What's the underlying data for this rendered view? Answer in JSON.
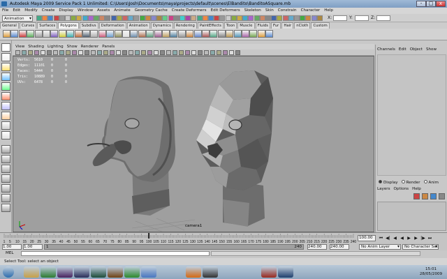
{
  "window": {
    "title": "Autodesk Maya 2009 Service Pack 1 Unlimited: C:\\Users\\Josh\\Documents\\maya\\projects\\default\\scenes\\ElBandito\\BanditoASquare.mb",
    "minimize": "-",
    "maximize": "□",
    "close": "x"
  },
  "menubar": [
    "File",
    "Edit",
    "Modify",
    "Create",
    "Display",
    "Window",
    "Assets",
    "Animate",
    "Geometry Cache",
    "Create Deformers",
    "Edit Deformers",
    "Skeleton",
    "Skin",
    "Constrain",
    "Character",
    "Help"
  ],
  "statusline": {
    "mode": "Animation",
    "x_label": "X:",
    "y_label": "Y:",
    "z_label": "Z:"
  },
  "shelf_tabs": [
    "General",
    "Curves",
    "Surfaces",
    "Polygons",
    "Subdivs",
    "Deformation",
    "Animation",
    "Dynamics",
    "Rendering",
    "PaintEffects",
    "Toon",
    "Muscle",
    "Fluids",
    "Fur",
    "Hair",
    "nCloth",
    "Custom"
  ],
  "shelf_active": "Polygons",
  "panel_menu": [
    "View",
    "Shading",
    "Lighting",
    "Show",
    "Renderer",
    "Panels"
  ],
  "hud": {
    "rows": [
      {
        "label": "Verts:",
        "v1": "5610",
        "v2": "0",
        "v3": "0"
      },
      {
        "label": "Edges:",
        "v1": "11101",
        "v2": "0",
        "v3": "0"
      },
      {
        "label": "Faces:",
        "v1": "5444",
        "v2": "0",
        "v3": "0"
      },
      {
        "label": "Tris:",
        "v1": "10889",
        "v2": "0",
        "v3": "0"
      },
      {
        "label": "UVs:",
        "v1": "6478",
        "v2": "0",
        "v3": "0"
      }
    ],
    "camera": "camera1"
  },
  "channel_box": {
    "tabs": [
      "Channels",
      "Edit",
      "Object",
      "Show"
    ],
    "layer_modes": [
      "Display",
      "Render",
      "Anim"
    ],
    "layer_menu": [
      "Layers",
      "Options",
      "Help"
    ]
  },
  "timeline": {
    "ticks": [
      "1",
      "5",
      "10",
      "15",
      "20",
      "25",
      "30",
      "35",
      "40",
      "45",
      "50",
      "55",
      "60",
      "65",
      "70",
      "75",
      "80",
      "85",
      "90",
      "95",
      "100",
      "105",
      "110",
      "115",
      "120",
      "125",
      "130",
      "135",
      "140",
      "145",
      "150",
      "155",
      "160",
      "165",
      "170",
      "175",
      "180",
      "185",
      "190",
      "195",
      "200",
      "205",
      "210",
      "215",
      "220",
      "225",
      "230",
      "235",
      "240"
    ],
    "current_frame": "100.00",
    "range_start": "1.00",
    "range_start2": "1.00",
    "range_field": "1",
    "range_end": "240",
    "anim_end": "240.00",
    "anim_end2": "240.00",
    "anim_layer": "No Anim Layer",
    "character_set": "No Character Set"
  },
  "mel": {
    "label": "MEL"
  },
  "helpline": "Select Tool: select an object",
  "taskbar": {
    "clock_time": "15:01",
    "clock_date": "28/05/2009",
    "apps": [
      {
        "name": "start-orb",
        "color": "#2f6fb0"
      },
      {
        "name": "explorer",
        "color": "#c9a24a"
      },
      {
        "name": "media-player",
        "color": "#2e7d32"
      },
      {
        "name": "premiere",
        "color": "#4a2460"
      },
      {
        "name": "after-effects",
        "color": "#2b2f5a"
      },
      {
        "name": "soundbooth",
        "color": "#1f4d3a"
      },
      {
        "name": "bridge",
        "color": "#704214"
      },
      {
        "name": "app-green",
        "color": "#2d8b2d"
      },
      {
        "name": "itunes",
        "color": "#4a78c2"
      },
      {
        "name": "firefox",
        "color": "#d66a14"
      },
      {
        "name": "media",
        "color": "#333333"
      },
      {
        "name": "maya",
        "color": "#9a2a20"
      },
      {
        "name": "photoshop",
        "color": "#20406e"
      }
    ]
  }
}
